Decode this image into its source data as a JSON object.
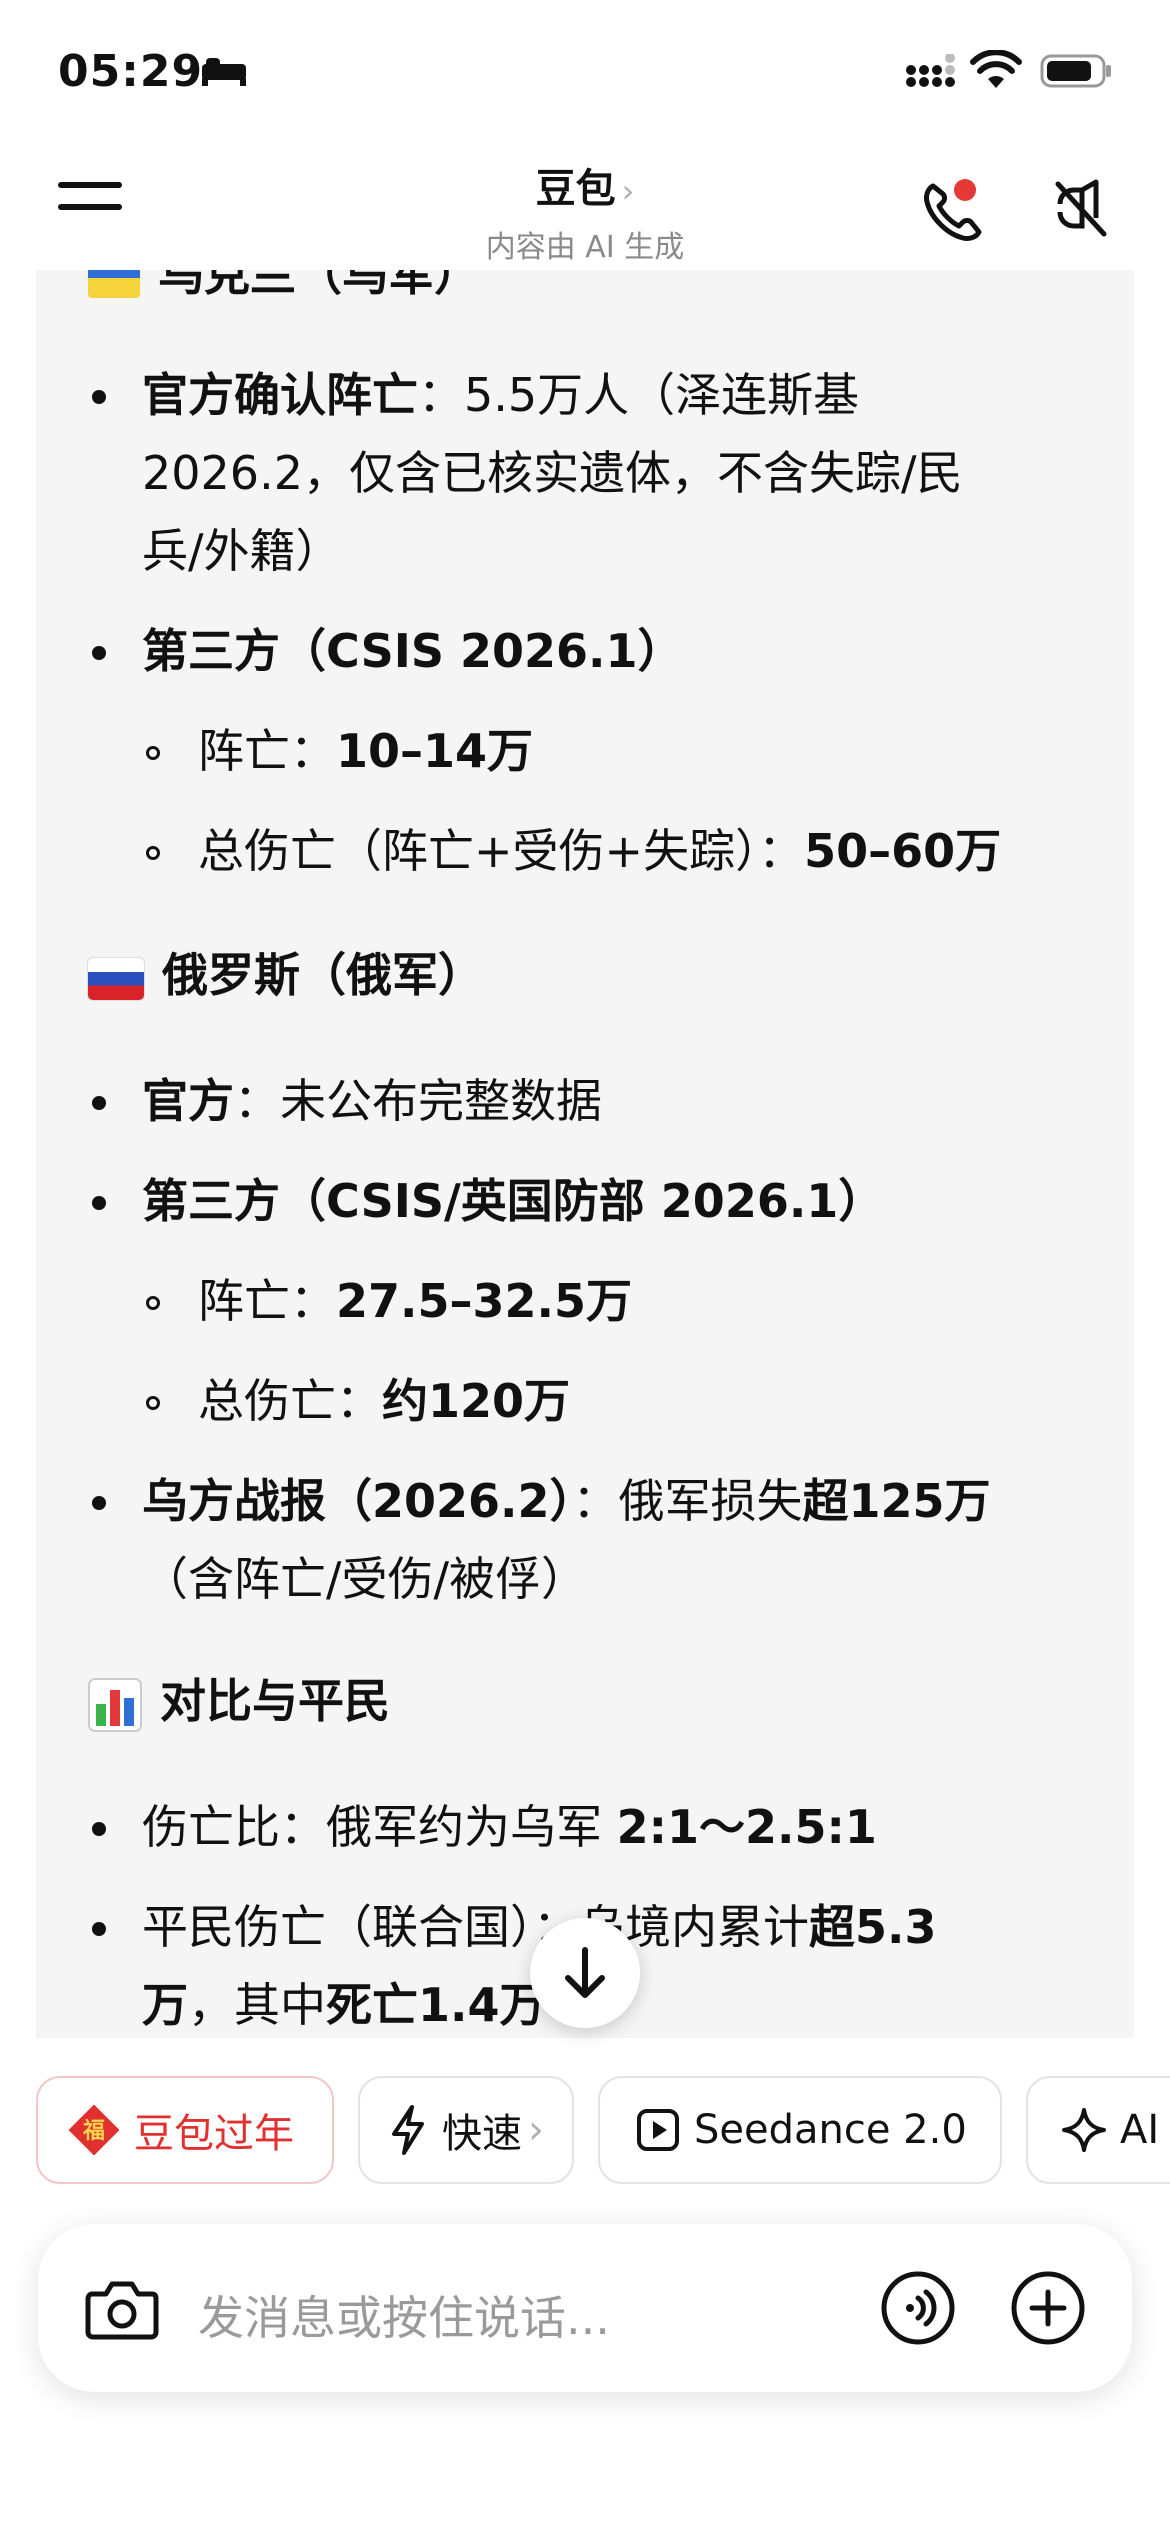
{
  "status_bar": {
    "time": "05:29"
  },
  "header": {
    "title": "豆包",
    "chevron": "›",
    "subtitle": "内容由 AI 生成"
  },
  "content": {
    "cut_heading": "乌克兰（乌军）",
    "ua_items": [
      {
        "bold": "官方确认阵亡",
        "text": "：5.5万人（泽连斯基",
        "line2": "2026.2，仅含已核实遗体，不含失踪/民",
        "line3": "兵/外籍）"
      },
      {
        "bold": "第三方（CSIS 2026.1）"
      }
    ],
    "ua_sub": [
      {
        "text": "阵亡：",
        "bold": "10–14万"
      },
      {
        "text": "总伤亡（阵亡+受伤+失踪）：",
        "bold": "50–60万"
      }
    ],
    "ru_heading": "俄罗斯（俄军）",
    "ru_items": [
      {
        "bold": "官方",
        "text": "：未公布完整数据"
      },
      {
        "bold": "第三方（CSIS/英国防部 2026.1）"
      }
    ],
    "ru_sub": [
      {
        "text": "阵亡：",
        "bold": "27.5–32.5万"
      },
      {
        "text": "总伤亡：",
        "bold": "约120万"
      }
    ],
    "ru_report": {
      "bold": "乌方战报（2026.2）",
      "text": "：俄军损失",
      "bold2": "超125万",
      "line2": "（含阵亡/受伤/被俘）"
    },
    "compare_heading": "对比与平民",
    "compare_items": [
      {
        "text": "伤亡比：俄军约为乌军 ",
        "bold": "2:1～2.5:1"
      },
      {
        "text": "平民伤亡（联合国）：乌境内累计",
        "bold": "超5.3",
        "line2_bold": "万",
        "line2_text": "，其中",
        "line2_bold2": "死亡1.4万"
      }
    ]
  },
  "chips": [
    {
      "label": "豆包过年",
      "icon": "fu-icon"
    },
    {
      "label": "快速",
      "icon": "lightning-icon",
      "chevron": "›"
    },
    {
      "label": "Seedance 2.0",
      "icon": "play-icon"
    },
    {
      "label": "AI",
      "icon": "sparkle-icon"
    }
  ],
  "input": {
    "placeholder": "发消息或按住说话..."
  },
  "colors": {
    "card_bg": "#f5f5f6",
    "accent_red": "#e0302f",
    "notification_dot": "#e53935"
  }
}
